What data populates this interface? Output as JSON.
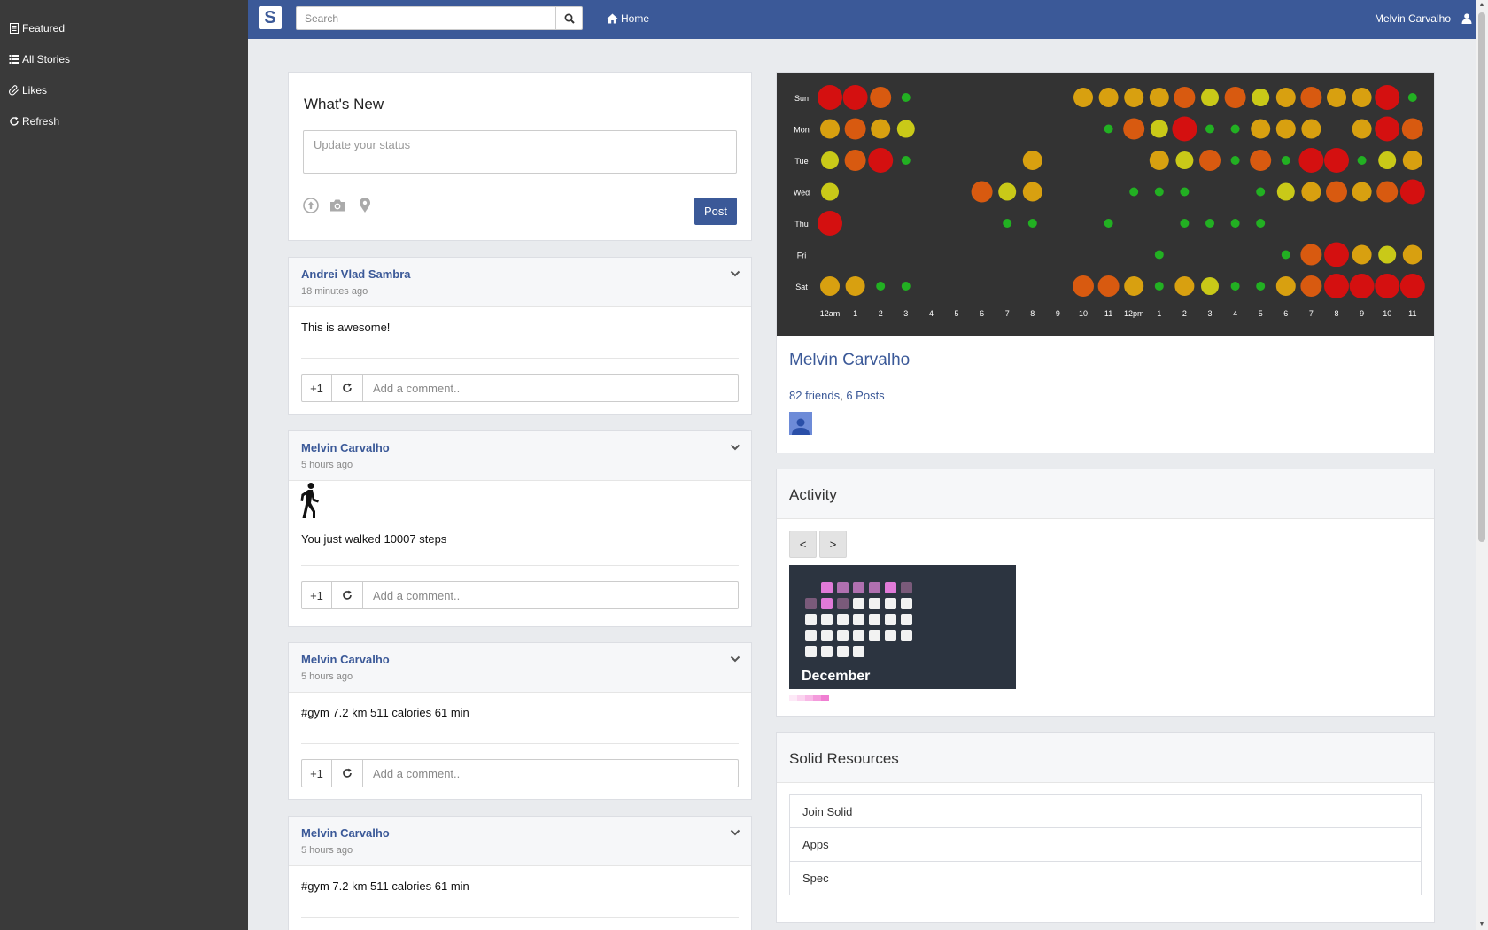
{
  "sidebar": {
    "items": [
      {
        "label": "Featured",
        "icon": "file-icon"
      },
      {
        "label": "All Stories",
        "icon": "list-icon"
      },
      {
        "label": "Likes",
        "icon": "paperclip-icon"
      },
      {
        "label": "Refresh",
        "icon": "refresh-icon"
      }
    ]
  },
  "topbar": {
    "logo": "S",
    "search_placeholder": "Search",
    "home_label": "Home",
    "user_name": "Melvin Carvalho"
  },
  "composer": {
    "title": "What's New",
    "placeholder": "Update your status",
    "post_label": "Post"
  },
  "posts": [
    {
      "author": "Andrei Vlad Sambra",
      "time": "18 minutes ago",
      "text": "This is awesome!",
      "plus": "+1",
      "comment_placeholder": "Add a comment.."
    },
    {
      "author": "Melvin Carvalho",
      "time": "5 hours ago",
      "text": "You just walked 10007 steps",
      "plus": "+1",
      "comment_placeholder": "Add a comment..",
      "icon": "walking-person-icon"
    },
    {
      "author": "Melvin Carvalho",
      "time": "5 hours ago",
      "text": "#gym 7.2 km 511 calories 61 min",
      "plus": "+1",
      "comment_placeholder": "Add a comment.."
    },
    {
      "author": "Melvin Carvalho",
      "time": "5 hours ago",
      "text": "#gym 7.2 km 511 calories 61 min",
      "plus": "+1",
      "comment_placeholder": "Add a comment.."
    }
  ],
  "profile": {
    "name": "Melvin Carvalho",
    "friends": "82 friends",
    "sep": ", ",
    "posts": "6 Posts"
  },
  "punchcard": {
    "days": [
      "Sun",
      "Mon",
      "Tue",
      "Wed",
      "Thu",
      "Fri",
      "Sat"
    ],
    "hours": [
      "12am",
      "1",
      "2",
      "3",
      "4",
      "5",
      "6",
      "7",
      "8",
      "9",
      "10",
      "11",
      "12pm",
      "1",
      "2",
      "3",
      "4",
      "5",
      "6",
      "7",
      "8",
      "9",
      "10",
      "11"
    ],
    "levels": [
      [
        5,
        5,
        4,
        1,
        0,
        0,
        0,
        0,
        0,
        0,
        3,
        3,
        3,
        3,
        4,
        2,
        4,
        2,
        3,
        4,
        3,
        3,
        5,
        1
      ],
      [
        3,
        4,
        3,
        2,
        0,
        0,
        0,
        0,
        0,
        0,
        0,
        1,
        4,
        2,
        5,
        1,
        1,
        3,
        3,
        3,
        0,
        3,
        5,
        4
      ],
      [
        2,
        4,
        5,
        1,
        0,
        0,
        0,
        0,
        3,
        0,
        0,
        0,
        0,
        3,
        2,
        4,
        1,
        4,
        1,
        5,
        5,
        1,
        2,
        3
      ],
      [
        2,
        0,
        0,
        0,
        0,
        0,
        4,
        2,
        3,
        0,
        0,
        0,
        1,
        1,
        1,
        0,
        0,
        1,
        2,
        3,
        4,
        3,
        4,
        5
      ],
      [
        5,
        0,
        0,
        0,
        0,
        0,
        0,
        1,
        1,
        0,
        0,
        1,
        0,
        0,
        1,
        1,
        1,
        1,
        0,
        0,
        0,
        0,
        0,
        0
      ],
      [
        0,
        0,
        0,
        0,
        0,
        0,
        0,
        0,
        0,
        0,
        0,
        0,
        0,
        1,
        0,
        0,
        0,
        0,
        1,
        4,
        5,
        3,
        2,
        3
      ],
      [
        3,
        3,
        1,
        1,
        0,
        0,
        0,
        0,
        0,
        0,
        4,
        4,
        3,
        1,
        3,
        2,
        1,
        1,
        3,
        4,
        5,
        5,
        5,
        5
      ]
    ],
    "colors": {
      "1": "#22b022",
      "2": "#c9c918",
      "3": "#d8a010",
      "4": "#d85a10",
      "5": "#d41010"
    }
  },
  "activity": {
    "title": "Activity",
    "prev_label": "<",
    "next_label": ">",
    "month": "December",
    "calendar": [
      [
        null,
        3,
        2,
        2,
        2,
        3,
        1
      ],
      [
        1,
        3,
        1,
        0,
        0,
        0,
        0
      ],
      [
        0,
        0,
        0,
        0,
        0,
        0,
        0
      ],
      [
        0,
        0,
        0,
        0,
        0,
        0,
        0
      ],
      [
        0,
        0,
        0,
        0,
        null,
        null,
        null
      ]
    ],
    "calendar_colors": {
      "0": "#f2f2f2",
      "1": "#7a5a7a",
      "2": "#b070b0",
      "3": "#e07ad8"
    },
    "legend_colors": [
      "#fde9f7",
      "#fbd3ef",
      "#f8b8e6",
      "#f49bdc",
      "#f07ed2"
    ]
  },
  "resources": {
    "title": "Solid Resources",
    "items": [
      "Join Solid",
      "Apps",
      "Spec"
    ]
  }
}
